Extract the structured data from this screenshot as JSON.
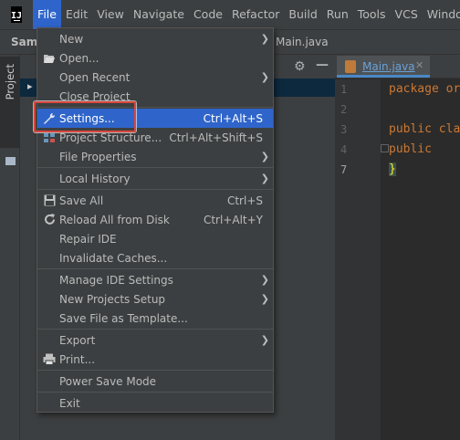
{
  "menubar": {
    "logo": "IJ",
    "items": [
      "File",
      "Edit",
      "View",
      "Navigate",
      "Code",
      "Refactor",
      "Build",
      "Run",
      "Tools",
      "VCS",
      "Window"
    ]
  },
  "navbar": {
    "project": "Samp",
    "file": "Main.java"
  },
  "toolstripe": {
    "label": "Project"
  },
  "editor": {
    "tab": "Main.java",
    "line_numbers": [
      "1",
      "2",
      "3",
      "4",
      "7"
    ],
    "code": [
      "package or",
      "",
      "public cla",
      "    public",
      "}"
    ]
  },
  "file_menu": {
    "new": "New",
    "open": "Open...",
    "open_recent": "Open Recent",
    "close_project": "Close Project",
    "settings": "Settings...",
    "settings_shortcut": "Ctrl+Alt+S",
    "project_structure": "Project Structure...",
    "project_structure_shortcut": "Ctrl+Alt+Shift+S",
    "file_properties": "File Properties",
    "local_history": "Local History",
    "save_all": "Save All",
    "save_all_shortcut": "Ctrl+S",
    "reload": "Reload All from Disk",
    "reload_shortcut": "Ctrl+Alt+Y",
    "repair": "Repair IDE",
    "invalidate": "Invalidate Caches...",
    "manage_ide": "Manage IDE Settings",
    "new_projects_setup": "New Projects Setup",
    "save_template": "Save File as Template...",
    "export": "Export",
    "print": "Print...",
    "power_save": "Power Save Mode",
    "exit": "Exit"
  },
  "colors": {
    "highlight": "#2f65ca",
    "annotation": "#d9463c"
  }
}
